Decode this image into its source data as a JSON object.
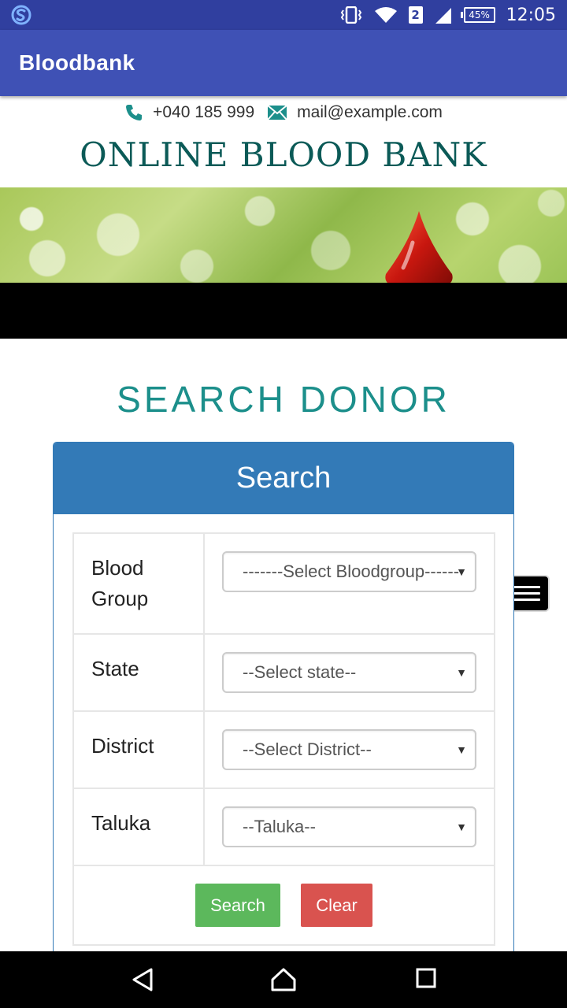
{
  "status_bar": {
    "time": "12:05",
    "battery": "45%",
    "sim": "2",
    "icons": [
      "s-app-icon",
      "vibrate-icon",
      "wifi-icon",
      "sim-icon",
      "signal-icon",
      "battery-icon"
    ]
  },
  "app_bar": {
    "title": "Bloodbank"
  },
  "contact": {
    "phone": "+040 185 999",
    "email": "mail@example.com"
  },
  "site_title": "ONLINE BLOOD BANK",
  "page_heading": "SEARCH DONOR",
  "panel": {
    "title": "Search",
    "rows": [
      {
        "label_line1": "Blood",
        "label_line2": "Group",
        "select": "-------Select Bloodgroup------"
      },
      {
        "label": "State",
        "select": "--Select state--"
      },
      {
        "label": "District",
        "select": "--Select District--"
      },
      {
        "label": "Taluka",
        "select": "--Taluka--"
      }
    ],
    "search_button": "Search",
    "clear_button": "Clear"
  },
  "colors": {
    "status_bar": "#303F9F",
    "app_bar": "#3F51B5",
    "heading": "#1c8f8b",
    "panel_header": "#337ab7",
    "search_button": "#5cb85c",
    "clear_button": "#d9534f"
  }
}
